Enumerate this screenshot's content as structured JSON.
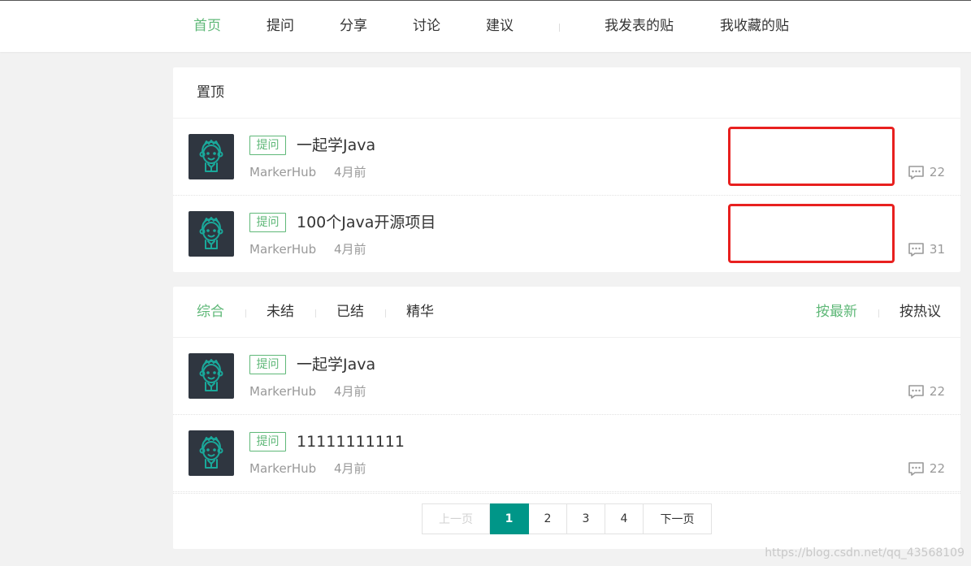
{
  "nav": {
    "items": [
      {
        "label": "首页",
        "active": true
      },
      {
        "label": "提问",
        "active": false
      },
      {
        "label": "分享",
        "active": false
      },
      {
        "label": "讨论",
        "active": false
      },
      {
        "label": "建议",
        "active": false
      }
    ],
    "user_links": [
      {
        "label": "我发表的贴"
      },
      {
        "label": "我收藏的贴"
      }
    ]
  },
  "pinned": {
    "title": "置顶",
    "posts": [
      {
        "tag": "提问",
        "title": "一起学Java",
        "author": "MarkerHub",
        "time": "4月前",
        "comments": "22"
      },
      {
        "tag": "提问",
        "title": "100个Java开源项目",
        "author": "MarkerHub",
        "time": "4月前",
        "comments": "31"
      }
    ]
  },
  "list": {
    "filters": [
      {
        "label": "综合",
        "active": true
      },
      {
        "label": "未结",
        "active": false
      },
      {
        "label": "已结",
        "active": false
      },
      {
        "label": "精华",
        "active": false
      }
    ],
    "sorts": [
      {
        "label": "按最新",
        "active": true
      },
      {
        "label": "按热议",
        "active": false
      }
    ],
    "posts": [
      {
        "tag": "提问",
        "title": "一起学Java",
        "author": "MarkerHub",
        "time": "4月前",
        "comments": "22"
      },
      {
        "tag": "提问",
        "title": "11111111111",
        "author": "MarkerHub",
        "time": "4月前",
        "comments": "22"
      }
    ]
  },
  "pager": {
    "prev": "上一页",
    "pages": [
      "1",
      "2",
      "3",
      "4"
    ],
    "current": "1",
    "next": "下一页"
  },
  "watermark": "https://blog.csdn.net/qq_43568109",
  "colors": {
    "accent": "#5fb878",
    "pager_active": "#009688",
    "annotation_red": "#e8201f"
  }
}
